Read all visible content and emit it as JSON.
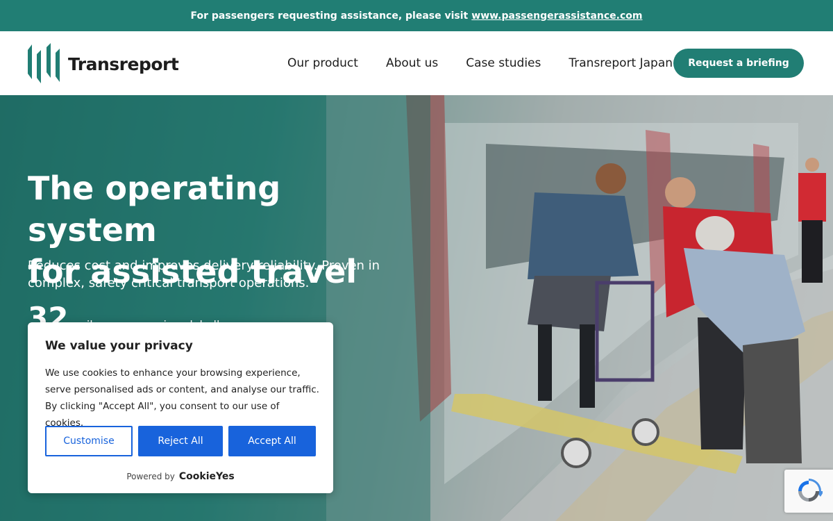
{
  "topbar": {
    "text": "For passengers requesting assistance, please visit",
    "link": "www.passengerassistance.com"
  },
  "header": {
    "logo_text": "Transreport",
    "nav": [
      "Our product",
      "About us",
      "Case studies",
      "Transreport Japan"
    ],
    "cta_label": "Request a briefing"
  },
  "hero": {
    "title_line1": "The operating system",
    "title_line2": "for assisted travel",
    "subtitle": "Reduces cost and improves delivery reliability. Proven in complex, safety critical transport operations.",
    "stat_number": "32",
    "stat_text": "railway companies globally"
  },
  "cookie_banner": {
    "title": "We value your privacy",
    "body": "We use cookies to enhance your browsing experience, serve personalised ads or content, and analyse our traffic. By clicking \"Accept All\", you consent to our use of cookies.",
    "customise_label": "Customise",
    "reject_label": "Reject All",
    "accept_label": "Accept All",
    "powered_by": "Powered by",
    "powered_brand": "CookieYes"
  },
  "colors": {
    "brand_teal": "#217e74",
    "cookie_blue": "#1863dc"
  },
  "icons": {
    "logo": "transreport-logo-icon",
    "recaptcha": "recaptcha-icon"
  }
}
